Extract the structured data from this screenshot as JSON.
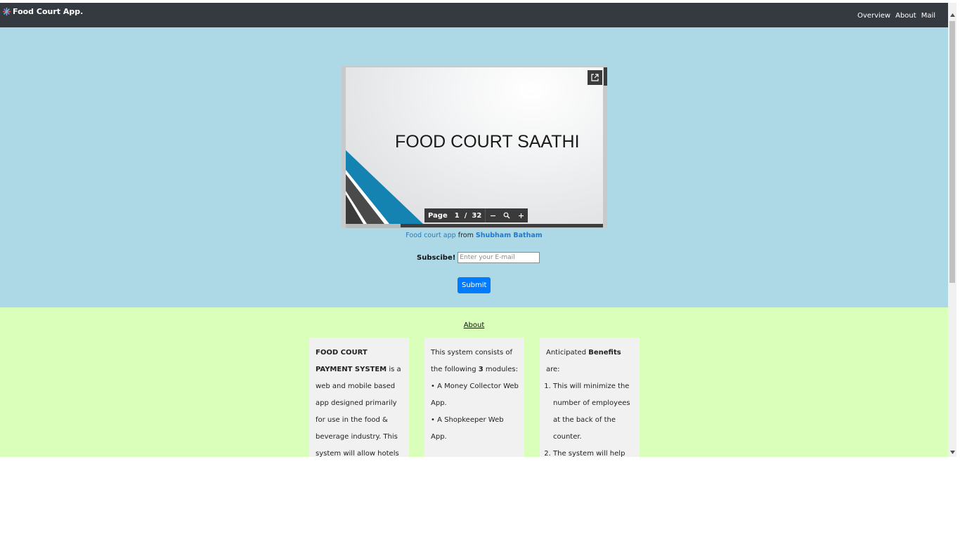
{
  "brand": {
    "title": "Food Court App."
  },
  "nav": {
    "overview": "Overview",
    "about": "About",
    "mail": "Mail"
  },
  "slide": {
    "title": "FOOD COURT SAATHI",
    "page_label": "Page",
    "current_page": "1",
    "page_separator": "/",
    "total_pages": "32"
  },
  "attribution": {
    "link_text": "Food court app",
    "from_text": "from",
    "author": "Shubham Batham"
  },
  "subscribe": {
    "label": "Subscibe!",
    "placeholder": "Enter your E-mail",
    "submit_label": "Submit"
  },
  "about": {
    "heading": "About",
    "card1": {
      "bold": "FOOD COURT PAYMENT SYSTEM",
      "text": " is a web and mobile based app designed primarily for use in the food & beverage industry. This system will allow hotels"
    },
    "card2": {
      "intro_pre": "This system consists of the following ",
      "count": "3",
      "intro_post": " modules:",
      "modules": [
        "• A Money Collector Web App.",
        "• A Shopkeeper Web App."
      ]
    },
    "card3": {
      "intro_pre": "Anticipated ",
      "bold": "Benefits",
      "intro_post": " are:",
      "benefits": [
        "This will minimize the number of employees at the back of the counter.",
        "The system will help"
      ]
    }
  },
  "colors": {
    "navbar": "#343a40",
    "hero_bg": "#add8e6",
    "about_bg": "#d9ffba",
    "card_bg": "#f1f1f2",
    "primary_button": "#007bff",
    "link": "#1e7ad6"
  },
  "icons": {
    "brand": "star-burst-icon",
    "popout": "external-link-icon",
    "zoom_out": "minus-icon",
    "zoom_reset": "magnifier-icon",
    "zoom_in": "plus-icon"
  }
}
